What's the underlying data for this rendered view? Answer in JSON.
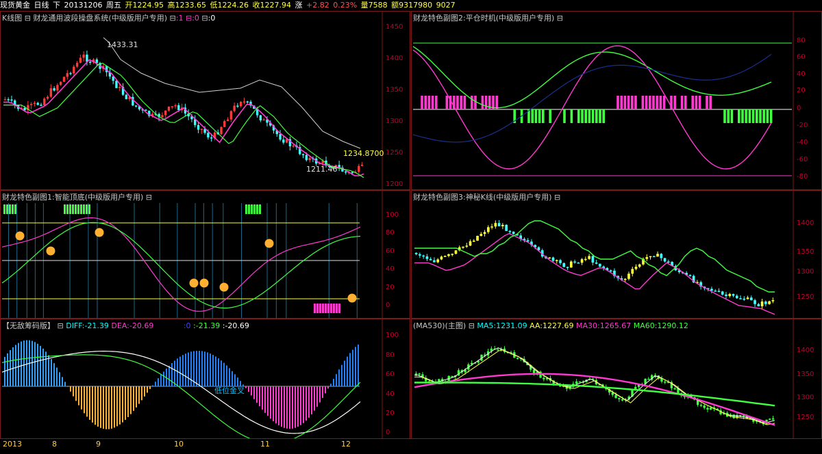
{
  "topbar": {
    "title": "现货黄金",
    "period": "日线",
    "dir": "下",
    "date": "20131206",
    "weekday": "周五",
    "open": "开1224.95",
    "high": "高1233.65",
    "low": "低1224.26",
    "close": "收1227.94",
    "chg_label": "涨",
    "chg": "+2.82",
    "pct": "0.23%",
    "vol": "量7588",
    "amt": "额9317980",
    "extra": "9027"
  },
  "colors": {
    "bg": "#000000",
    "up": "#ff3a3a",
    "down": "#40ffff",
    "pink": "#ff3ad0",
    "green": "#40ff40",
    "yellow": "#ffff40",
    "axis": "#c00030",
    "border": "#7a1a1a"
  },
  "panels": {
    "kline": {
      "title": "K线图",
      "indicator": "财龙通用波段操盘系统(中级版用户专用)",
      "param1": ":1",
      "param2": ":0",
      "param3": ":0",
      "axis": [
        "1450",
        "1400",
        "1350",
        "1300",
        "1250",
        "1200"
      ],
      "ann_high": "1433.31",
      "ann_low": "1211.46",
      "ann_cur": "1234.8700"
    },
    "sub2": {
      "title": "财龙特色副图2:平仓时机(中级版用户专用)",
      "axis": [
        "80",
        "60",
        "40",
        "20",
        "0",
        "-20",
        "-40",
        "-60",
        "-80"
      ]
    },
    "sub1": {
      "title": "财龙特色副图1:智能顶底(中级版用户专用)",
      "axis": [
        "100",
        "80",
        "60",
        "40",
        "20",
        "0"
      ]
    },
    "sub3": {
      "title": "财龙特色副图3:神秘K线(中级版用户专用)",
      "axis": [
        "1400",
        "1350",
        "1300",
        "1250"
      ]
    },
    "macd": {
      "title": "【无敌筹码版】",
      "diff": "DIFF:-21.39",
      "dea": "DEA:-20.69",
      "v1": ":0",
      "v2": ":-21.39",
      "v3": ":-20.69",
      "annotation": "低位金叉",
      "axis": [
        "100",
        "80",
        "60",
        "40",
        "20",
        "0"
      ]
    },
    "ma": {
      "title": "(MA530)(主图)",
      "ma5": "MA5:1231.09",
      "aa": "AA:1227.69",
      "ma30": "MA30:1265.67",
      "ma60": "MA60:1290.12",
      "axis": [
        "1400",
        "1350",
        "1300",
        "1250"
      ]
    }
  },
  "dates": [
    "2013",
    "8",
    "9",
    "10",
    "11",
    "12"
  ]
}
